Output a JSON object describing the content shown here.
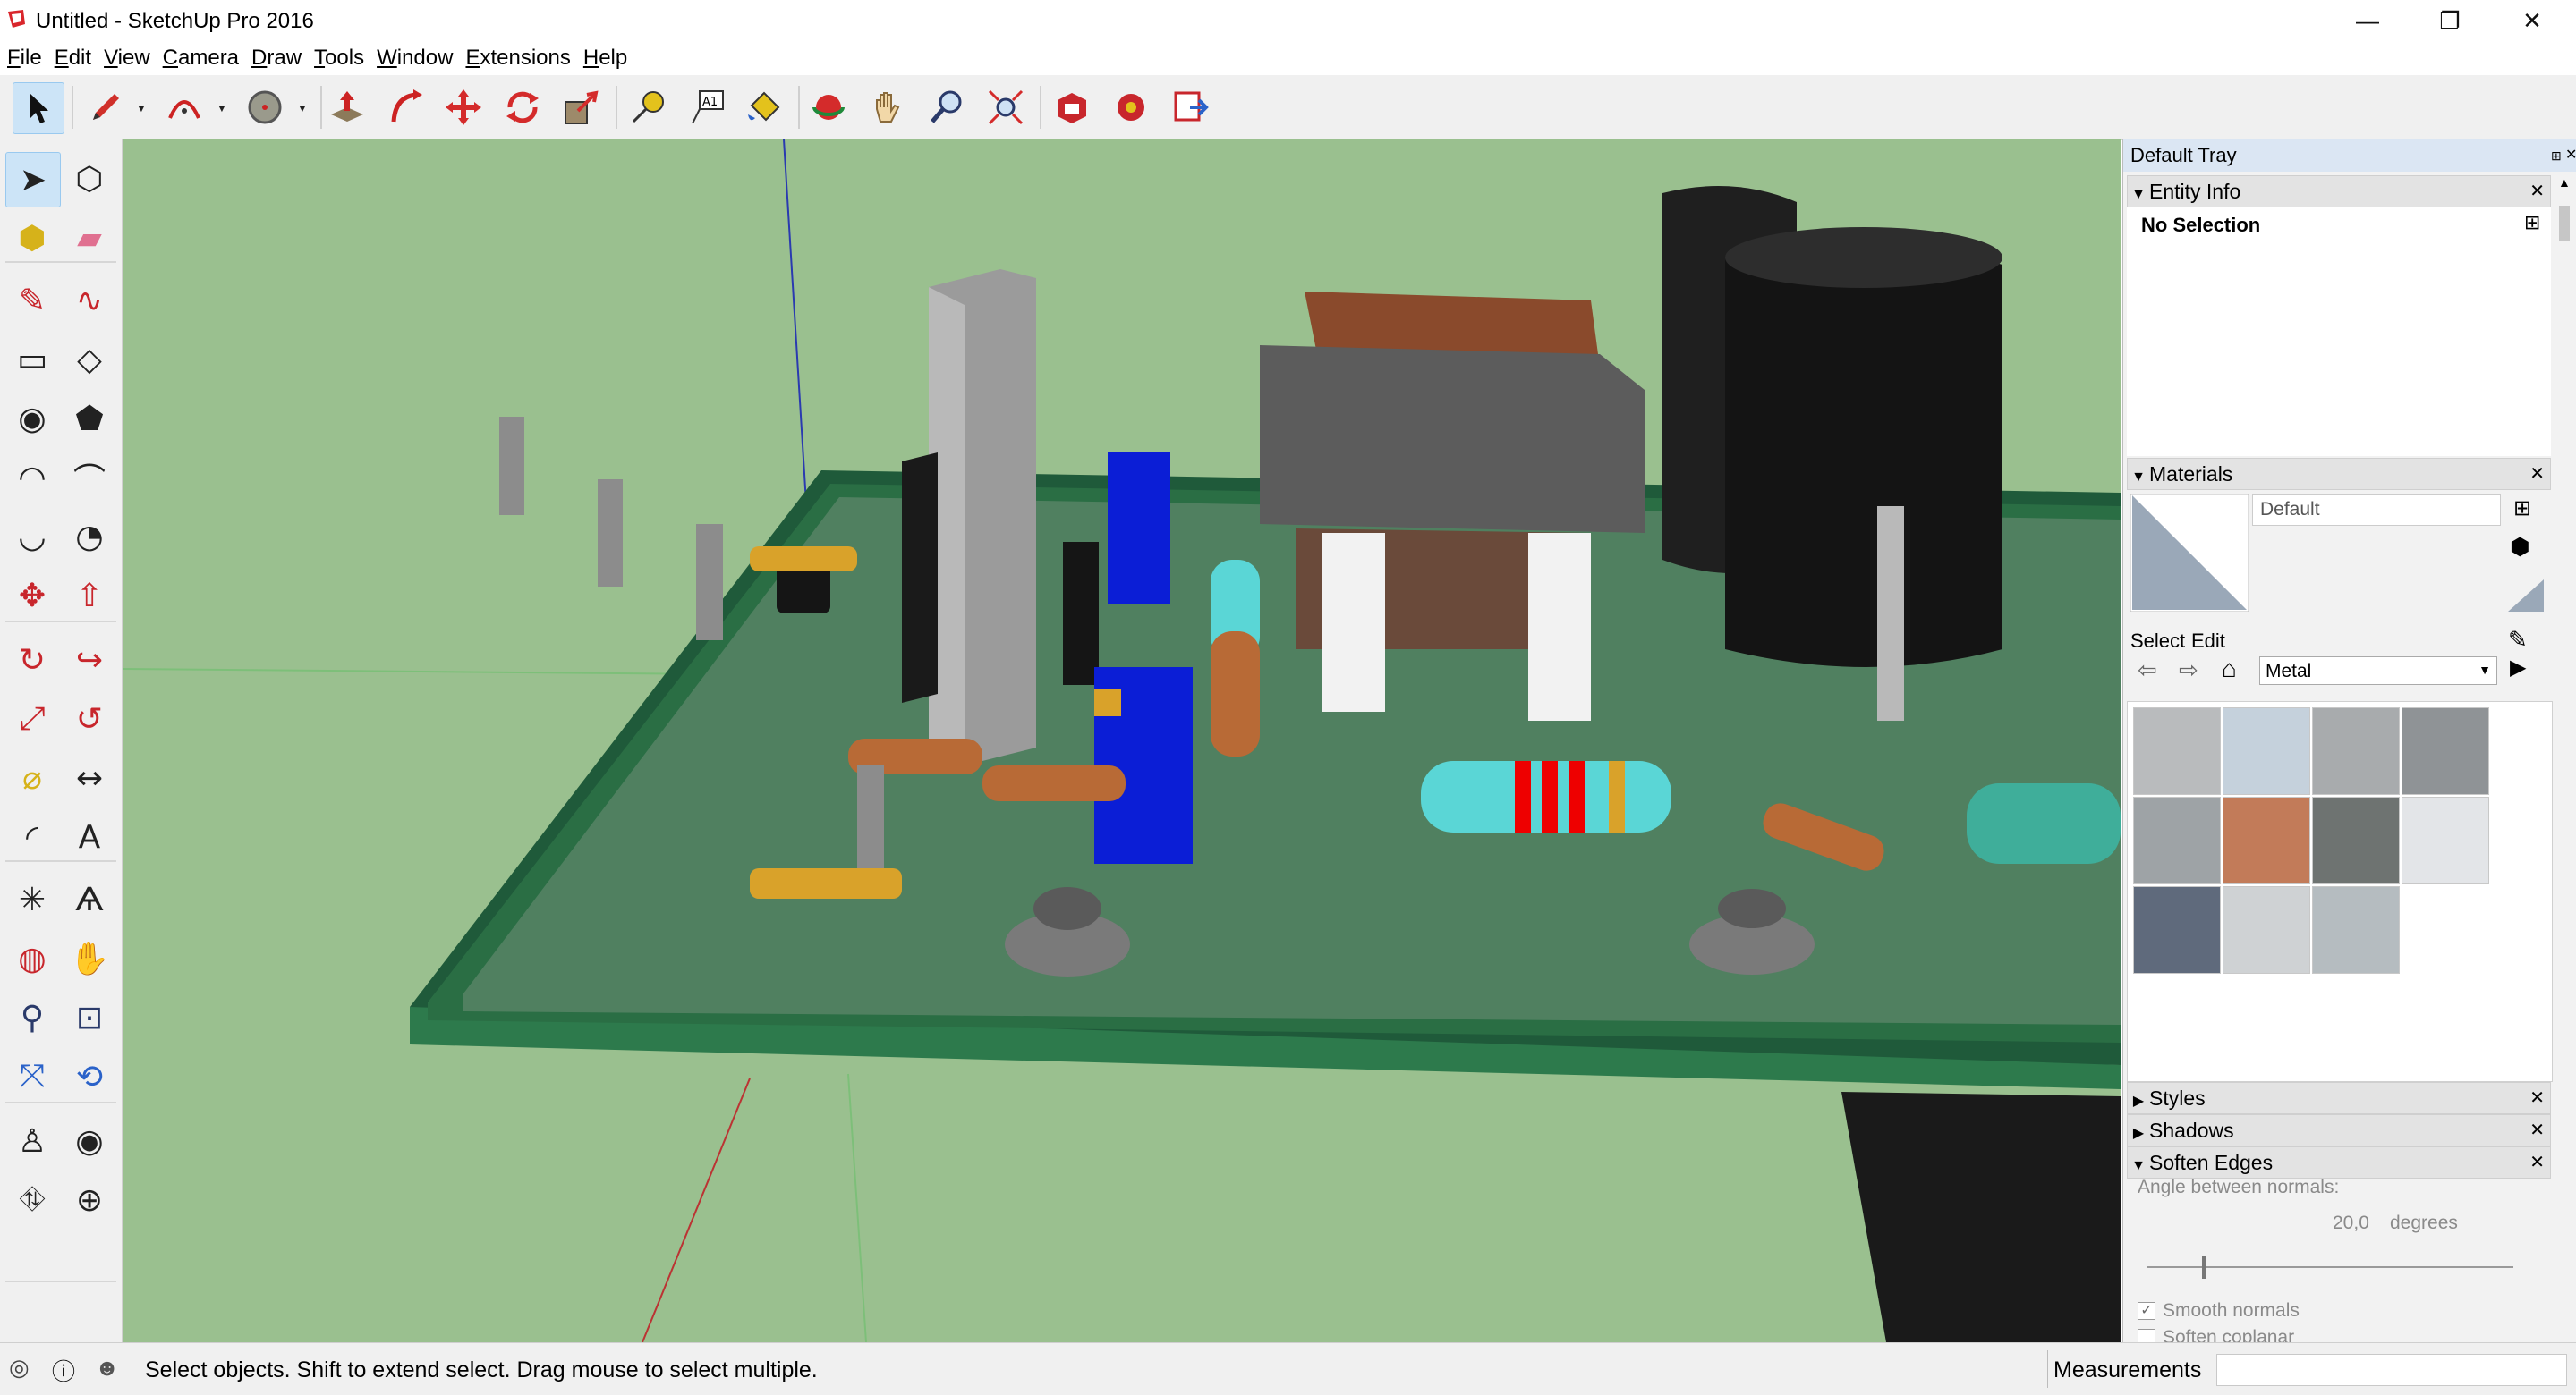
{
  "window": {
    "title": "Untitled - SketchUp Pro 2016",
    "controls": {
      "minimize": "—",
      "restore": "❐",
      "close": "✕"
    }
  },
  "menu": [
    "File",
    "Edit",
    "View",
    "Camera",
    "Draw",
    "Tools",
    "Window",
    "Extensions",
    "Help"
  ],
  "toolbar": {
    "tools": [
      "select-icon",
      "pencil-icon",
      "arc-icon",
      "circle-icon",
      "push-pull-icon",
      "follow-me-icon",
      "move-icon",
      "rotate-icon",
      "scale-icon",
      "tape-measure-icon",
      "text-icon",
      "paint-bucket-icon",
      "orbit-icon",
      "pan-icon",
      "zoom-icon",
      "zoom-extents-icon",
      "warehouse-icon",
      "extension-warehouse-icon",
      "send-to-layout-icon"
    ],
    "active": "select-icon"
  },
  "left_toolbar": {
    "tools": [
      "select-icon",
      "component-icon",
      "paint-bucket-icon",
      "eraser-icon",
      "line-icon",
      "freehand-icon",
      "rectangle-icon",
      "rotated-rectangle-icon",
      "circle-icon",
      "polygon-icon",
      "arc-icon",
      "two-point-arc-icon",
      "three-point-arc-icon",
      "pie-icon",
      "move-icon",
      "push-pull-icon",
      "rotate-icon",
      "follow-me-icon",
      "scale-icon",
      "offset-icon",
      "tape-measure-icon",
      "dimension-icon",
      "protractor-icon",
      "text-icon",
      "axes-icon",
      "3d-text-icon",
      "orbit-icon",
      "pan-icon",
      "zoom-icon",
      "zoom-window-icon",
      "zoom-extents-icon",
      "previous-view-icon",
      "position-camera-icon",
      "look-around-icon",
      "walk-icon",
      "section-plane-icon"
    ]
  },
  "tray": {
    "title": "Default Tray",
    "entity_info": {
      "header": "Entity Info",
      "value": "No Selection"
    },
    "materials": {
      "header": "Materials",
      "current": "Default",
      "tabs": [
        "Select",
        "Edit"
      ],
      "library": "Metal",
      "swatches": [
        "#b9bbbd",
        "#c5d1dc",
        "#a8abad",
        "#8f9396",
        "#9ea3a6",
        "#c27b59",
        "#6e7371",
        "#e3e5e8",
        "#5f6a7c",
        "#cfd2d4",
        "#b5bcc0"
      ]
    },
    "styles": {
      "header": "Styles"
    },
    "shadows": {
      "header": "Shadows"
    },
    "soften_edges": {
      "header": "Soften Edges",
      "label": "Angle between normals:",
      "value": "20,0",
      "unit": "degrees",
      "slider_fraction": 0.15,
      "smooth_normals": "Smooth normals",
      "soften_coplanar": "Soften coplanar",
      "smooth_normals_checked": true,
      "soften_coplanar_checked": false
    }
  },
  "status": {
    "message": "Select objects. Shift to extend select. Drag mouse to select multiple.",
    "measurements_label": "Measurements"
  }
}
